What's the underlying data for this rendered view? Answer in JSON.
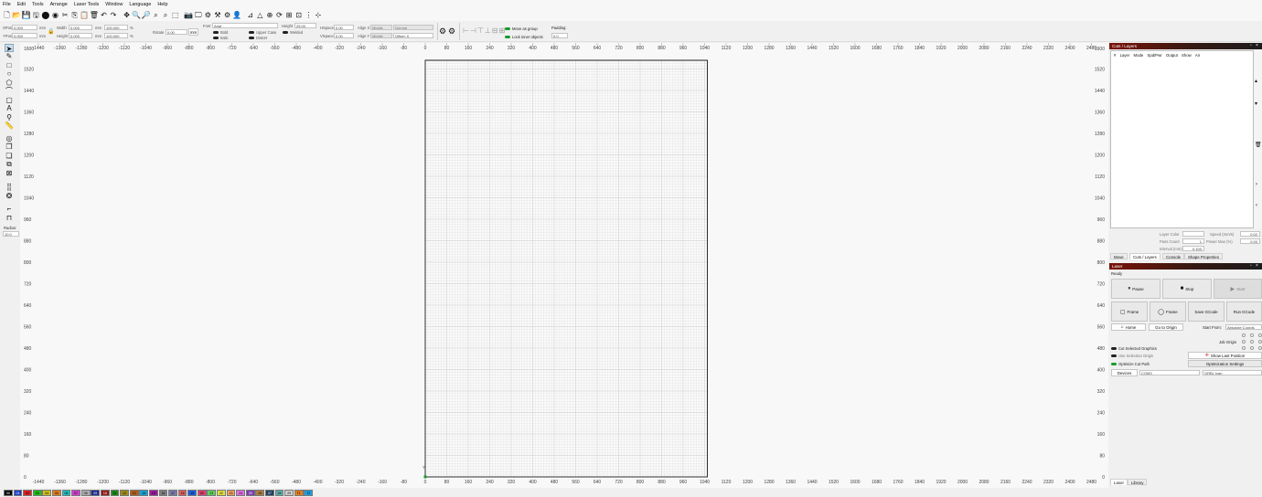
{
  "menu": [
    "File",
    "Edit",
    "Tools",
    "Arrange",
    "Laser Tools",
    "Window",
    "Language",
    "Help"
  ],
  "toolbar_icons": [
    "new-file-icon",
    "open-file-icon",
    "save-icon",
    "save-as-icon",
    "import-icon",
    "export-icon",
    "cut-icon",
    "copy-icon",
    "paste-icon",
    "delete-icon",
    "undo-icon",
    "redo-icon",
    "move-view-icon",
    "zoom-in-icon",
    "zoom-out-icon",
    "zoom-frame-icon",
    "zoom-page-icon",
    "zoom-selection-icon",
    "camera-icon",
    "monitor-icon",
    "settings-icon",
    "tools-icon",
    "gear-icon",
    "user-icon",
    "mirror-h-icon",
    "mirror-v-icon",
    "align-icon",
    "rotate-icon",
    "grid-icon",
    "array-icon",
    "distribute-icon",
    "more-icon"
  ],
  "props": {
    "xpos_label": "XPos",
    "xpos": "0.000",
    "ypos_label": "YPos",
    "ypos": "0.000",
    "mm": "mm",
    "width_label": "Width",
    "width": "0.000",
    "height_label": "Height",
    "height": "0.000",
    "pct1": "100.000",
    "pct2": "100.000",
    "pct": "%",
    "rotate_label": "Rotate",
    "rotate": "0.00",
    "unit_btn": "mm",
    "font_label": "Font",
    "font": "Arial",
    "height2_label": "Height",
    "height2": "25.00",
    "hspace_label": "HSpace",
    "hspace": "0.00",
    "vspace_label": "VSpace",
    "vspace": "0.00",
    "alignx_label": "Align X",
    "alignx": "Middle",
    "aligny_label": "Align Y",
    "aligny": "Middle",
    "normal": "Normal",
    "offset": "Offset: 0",
    "bold": "Bold",
    "italic": "Italic",
    "upper": "Upper Case",
    "distort": "Distort",
    "welded": "Welded",
    "move_group": "Move as group",
    "lock_inner": "Lock inner objects",
    "padding_label": "Padding:",
    "padding": "0.0"
  },
  "left_tools": [
    "select-arrow-icon",
    "pen-icon",
    "rectangle-icon",
    "ellipse-icon",
    "polygon-icon",
    "curve-icon",
    "rounded-rect-icon",
    "text-icon",
    "position-icon",
    "measure-icon",
    "offset-icon",
    "boolean-union-icon",
    "boolean-subtract-icon",
    "boolean-intersect-icon",
    "weld-icon",
    "grid-array-icon",
    "circular-array-icon",
    "corner-tool-icon",
    "edge-icon"
  ],
  "left_radius": {
    "label": "Radius:",
    "value": "10.0"
  },
  "canvas": {
    "ruler_x": [
      "-1440",
      "-1360",
      "-1280",
      "-1200",
      "-1120",
      "-1040",
      "-960",
      "-880",
      "-800",
      "-720",
      "-640",
      "-560",
      "-480",
      "-400",
      "-320",
      "-240",
      "-160",
      "-80",
      "0",
      "80",
      "160",
      "240",
      "320",
      "400",
      "480",
      "560",
      "640",
      "720",
      "800",
      "880",
      "960",
      "1040",
      "1120",
      "1200",
      "1280",
      "1360",
      "1440",
      "1520",
      "1600",
      "1680",
      "1760",
      "1840",
      "1920",
      "2000",
      "2080",
      "2160",
      "2240",
      "2320",
      "2400",
      "2480"
    ],
    "ruler_y": [
      "1600",
      "1520",
      "1440",
      "1360",
      "1280",
      "1200",
      "1120",
      "1040",
      "960",
      "880",
      "800",
      "720",
      "640",
      "560",
      "480",
      "400",
      "320",
      "240",
      "160",
      "80",
      "0"
    ],
    "origin_y": "Y",
    "ruler_x_min": -1440,
    "ruler_x_step": 80,
    "ruler_y_max": 1600,
    "ruler_y_step": 80,
    "bed_width": 1050,
    "bed_height": 1600
  },
  "cuts": {
    "title": "Cuts / Layers",
    "cols": [
      "#",
      "Layer",
      "Mode",
      "Spd/Pwr",
      "Output",
      "Show",
      "Air"
    ],
    "layer_color": "Layer Color",
    "speed": "Speed (mm/s)",
    "speed_val": "0.02",
    "pass_count": "Pass Count",
    "pass_val": "1",
    "power_max": "Power Max (%)",
    "power_val": "0.00",
    "interval": "Interval (mm)",
    "interval_val": "0.100"
  },
  "tabs": [
    "Move",
    "Cuts / Layers",
    "Console",
    "Shape Properties"
  ],
  "laser": {
    "title": "Laser",
    "status": "Ready",
    "pause": "Pause",
    "stop": "Stop",
    "start": "Start",
    "frame1": "Frame",
    "frame2": "Frame",
    "save_gcode": "Save GCode",
    "run_gcode": "Run GCode",
    "home": "Home",
    "go_origin": "Go to Origin",
    "start_from_label": "Start From:",
    "start_from": "Absolute Coords",
    "job_origin": "Job Origin",
    "cut_selected": "Cut Selected Graphics",
    "use_selection": "Use Selection Origin",
    "optimize": "Optimize Cut Path",
    "show_last": "Show Last Position",
    "opt_settings": "Optimization Settings",
    "devices": "Devices",
    "port": "COM3",
    "device": "GRBL Ivan"
  },
  "bottom_tabs": [
    "Laser",
    "Library"
  ],
  "palette": [
    {
      "id": "00",
      "color": "#000000"
    },
    {
      "id": "01",
      "color": "#1a3ec8"
    },
    {
      "id": "02",
      "color": "#e02020"
    },
    {
      "id": "03",
      "color": "#20c020"
    },
    {
      "id": "04",
      "color": "#d0c020"
    },
    {
      "id": "05",
      "color": "#e08020"
    },
    {
      "id": "06",
      "color": "#20c0c0"
    },
    {
      "id": "07",
      "color": "#d040d0"
    },
    {
      "id": "08",
      "color": "#b0b0b0"
    },
    {
      "id": "09",
      "color": "#1a2a90"
    },
    {
      "id": "10",
      "color": "#901a1a"
    },
    {
      "id": "11",
      "color": "#1a8a1a"
    },
    {
      "id": "12",
      "color": "#a08a1a"
    },
    {
      "id": "13",
      "color": "#b0601a"
    },
    {
      "id": "14",
      "color": "#1aa0d0"
    },
    {
      "id": "15",
      "color": "#a01aa0"
    },
    {
      "id": "16",
      "color": "#808080"
    },
    {
      "id": "17",
      "color": "#7a7aaa"
    },
    {
      "id": "18",
      "color": "#e06060"
    },
    {
      "id": "19",
      "color": "#2060e0"
    },
    {
      "id": "20",
      "color": "#e04070"
    },
    {
      "id": "21",
      "color": "#60d060"
    },
    {
      "id": "22",
      "color": "#e0e040"
    },
    {
      "id": "23",
      "color": "#f0a060"
    },
    {
      "id": "24",
      "color": "#e070e0"
    },
    {
      "id": "25",
      "color": "#7a3ab0"
    },
    {
      "id": "26",
      "color": "#b08040"
    },
    {
      "id": "27",
      "color": "#204060"
    },
    {
      "id": "28",
      "color": "#60b0b0"
    },
    {
      "id": "29",
      "color": "#d0d0d0"
    },
    {
      "id": "T1",
      "color": "#e08020"
    },
    {
      "id": "T2",
      "color": "#20a0e0"
    }
  ]
}
